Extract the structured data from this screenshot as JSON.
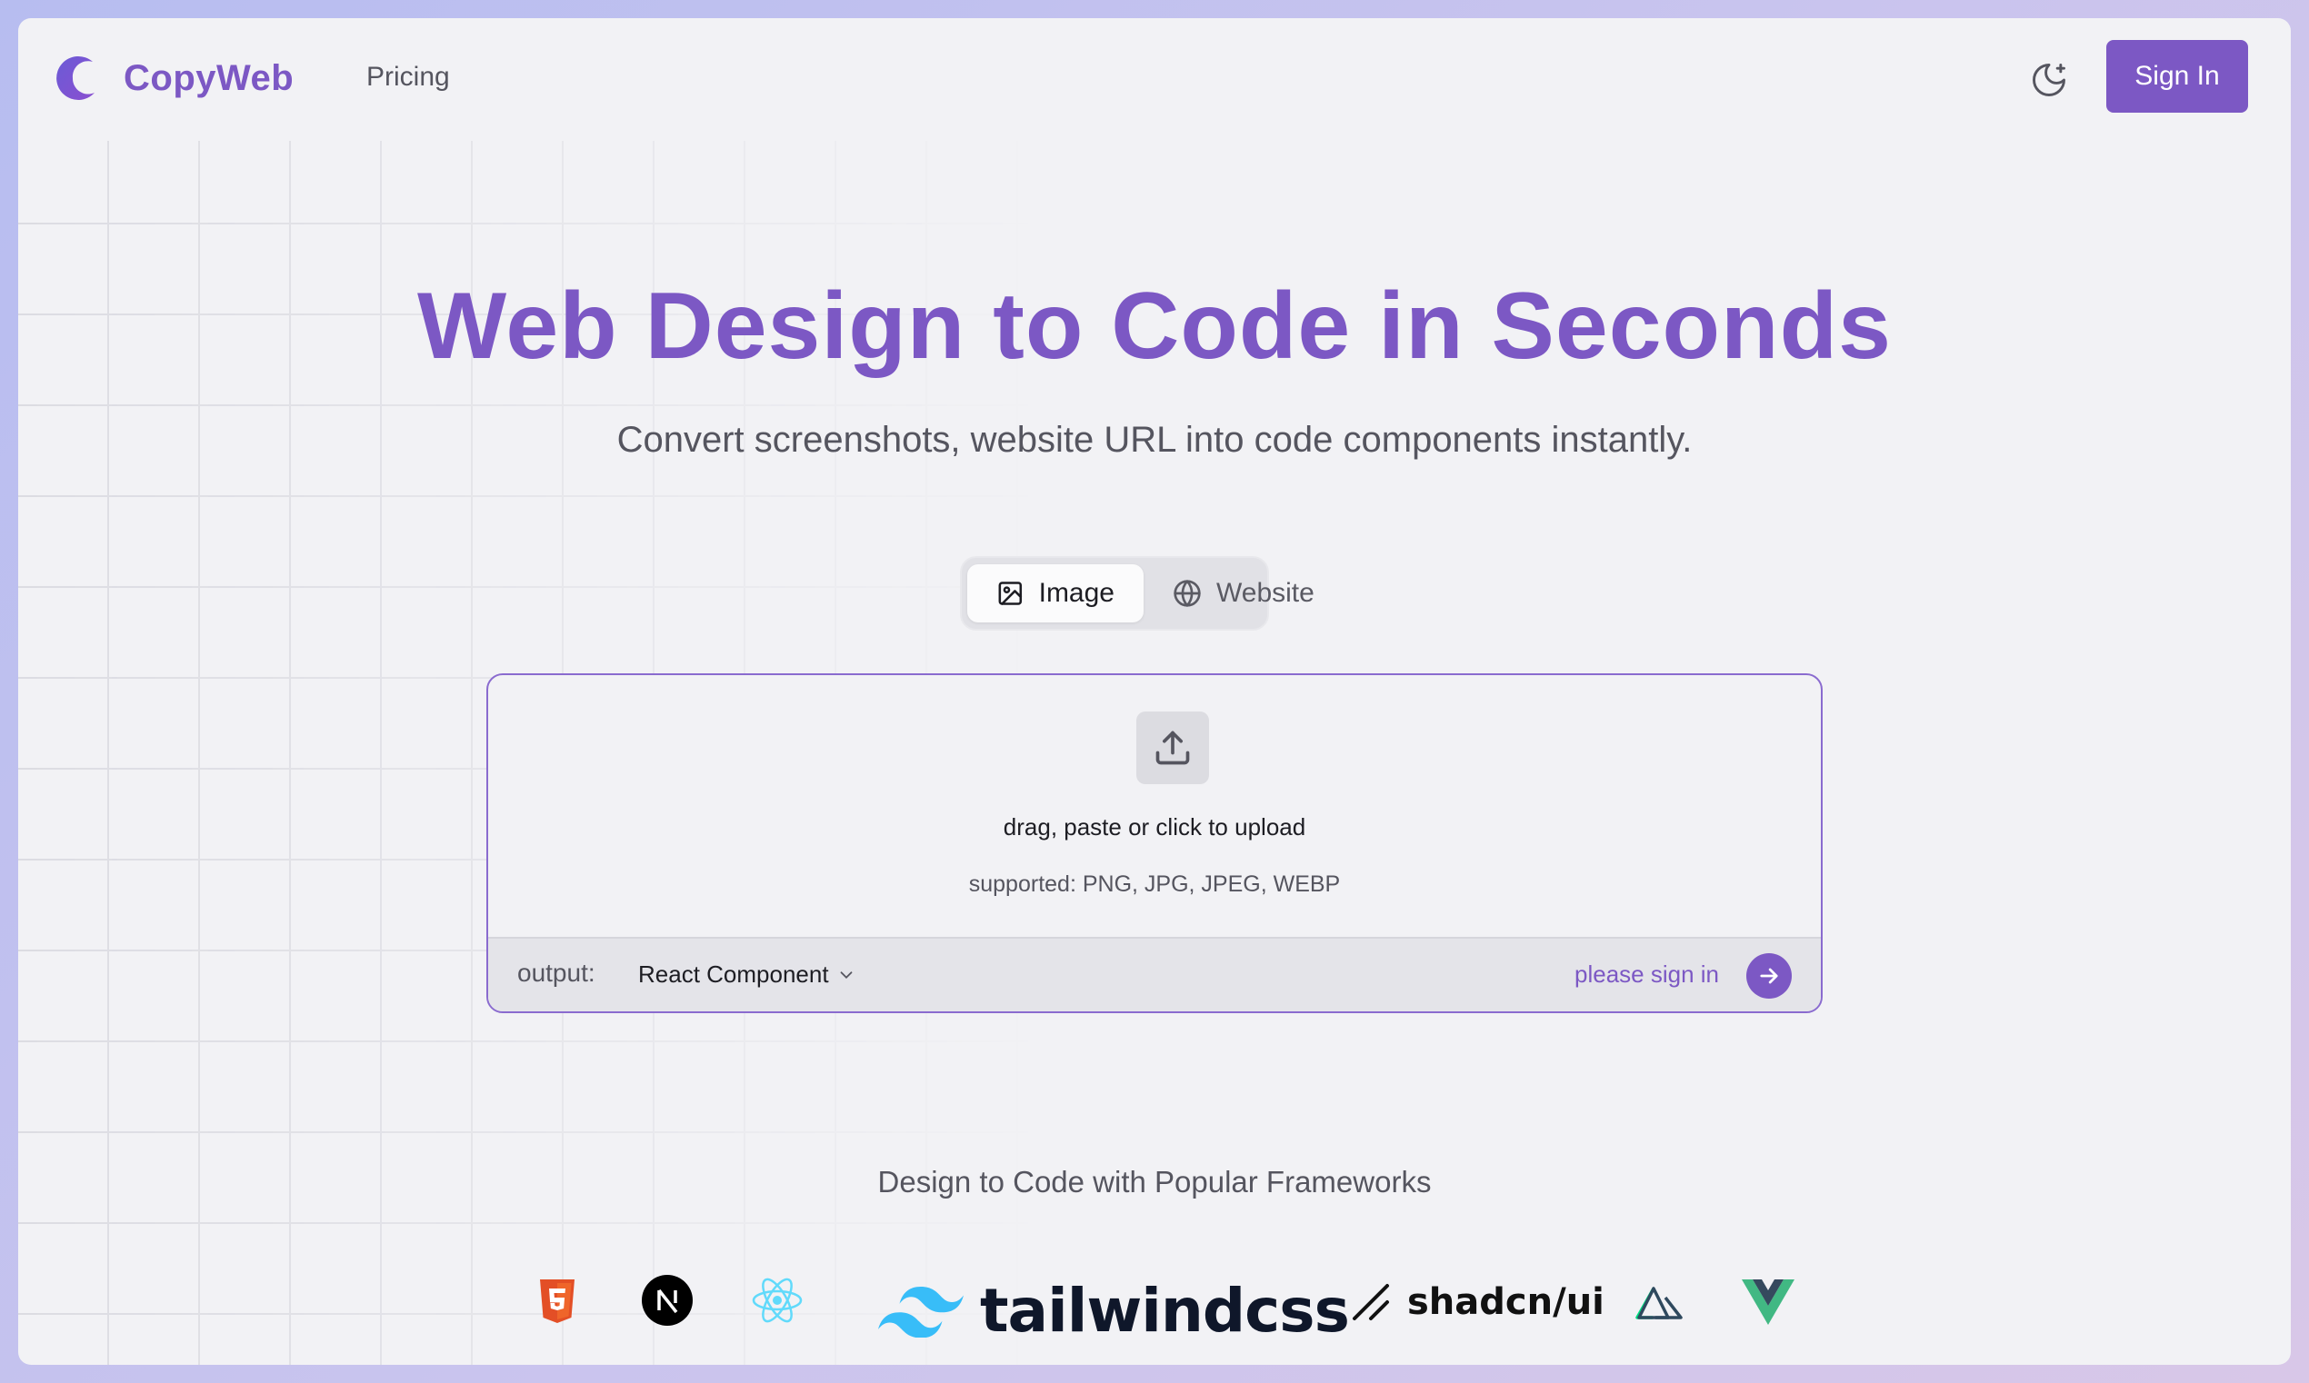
{
  "app": {
    "name": "CopyWeb",
    "brand_color": "#7c58c4"
  },
  "nav": {
    "pricing": "Pricing",
    "sign_in": "Sign In",
    "theme_icon": "moon-stars-icon"
  },
  "hero": {
    "title": "Web Design to Code in Seconds",
    "subtitle": "Convert screenshots, website URL into code components instantly."
  },
  "mode_toggle": {
    "tabs": [
      {
        "label": "Image",
        "icon": "image-icon",
        "active": true
      },
      {
        "label": "Website",
        "icon": "globe-icon",
        "active": false
      }
    ]
  },
  "upload": {
    "icon": "upload-icon",
    "instruction": "drag, paste or click to upload",
    "supported": "supported: PNG, JPG, JPEG, WEBP",
    "output_label": "output:",
    "output_value": "React Component",
    "sign_in_hint": "please sign in"
  },
  "frameworks": {
    "title": "Design to Code with Popular Frameworks",
    "items": [
      "html5-icon",
      "nextjs-icon",
      "react-icon",
      "tailwindcss",
      "shadcn/ui",
      "nuxt-icon",
      "vue-icon"
    ],
    "tailwind_label": "tailwindcss",
    "shadcn_label": "shadcn/ui"
  }
}
